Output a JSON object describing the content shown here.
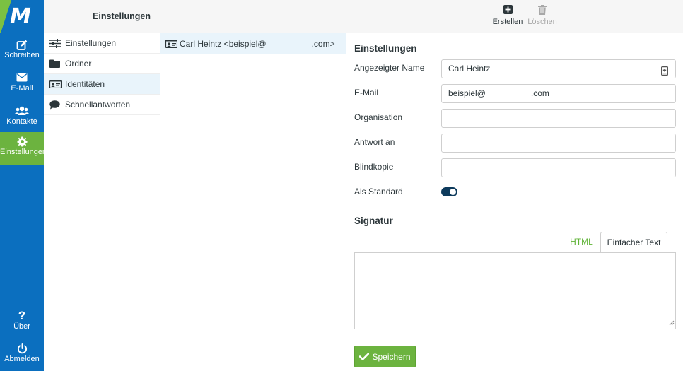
{
  "app": {
    "logo_letter": "M"
  },
  "nav": {
    "compose": "Schreiben",
    "mail": "E-Mail",
    "contacts": "Kontakte",
    "settings": "Einstellungen",
    "about": "Über",
    "logout": "Abmelden"
  },
  "settings_panel": {
    "title": "Einstellungen",
    "items": [
      {
        "label": "Einstellungen",
        "icon": "sliders-icon"
      },
      {
        "label": "Ordner",
        "icon": "folder-icon"
      },
      {
        "label": "Identitäten",
        "icon": "id-card-icon"
      },
      {
        "label": "Schnellantworten",
        "icon": "speech-bubble-icon"
      }
    ]
  },
  "identity_list": {
    "items": [
      {
        "name_prefix": "Carl Heintz <beispiel@",
        "name_suffix": ".com>"
      }
    ]
  },
  "toolbar": {
    "create": "Erstellen",
    "delete": "Löschen"
  },
  "form": {
    "section_title": "Einstellungen",
    "display_name_label": "Angezeigter Name",
    "display_name_value": "Carl Heintz",
    "email_label": "E-Mail",
    "email_prefix": "beispiel@",
    "email_suffix": ".com",
    "organization_label": "Organisation",
    "reply_to_label": "Antwort an",
    "bcc_label": "Blindkopie",
    "default_label": "Als Standard",
    "default_on": true
  },
  "signature": {
    "title": "Signatur",
    "tab_html": "HTML",
    "tab_plain": "Einfacher Text"
  },
  "save_label": "Speichern",
  "colors": {
    "nav_bg": "#0b6fbf",
    "accent_green": "#6cb33f",
    "toggle_on": "#0d3a5c"
  }
}
